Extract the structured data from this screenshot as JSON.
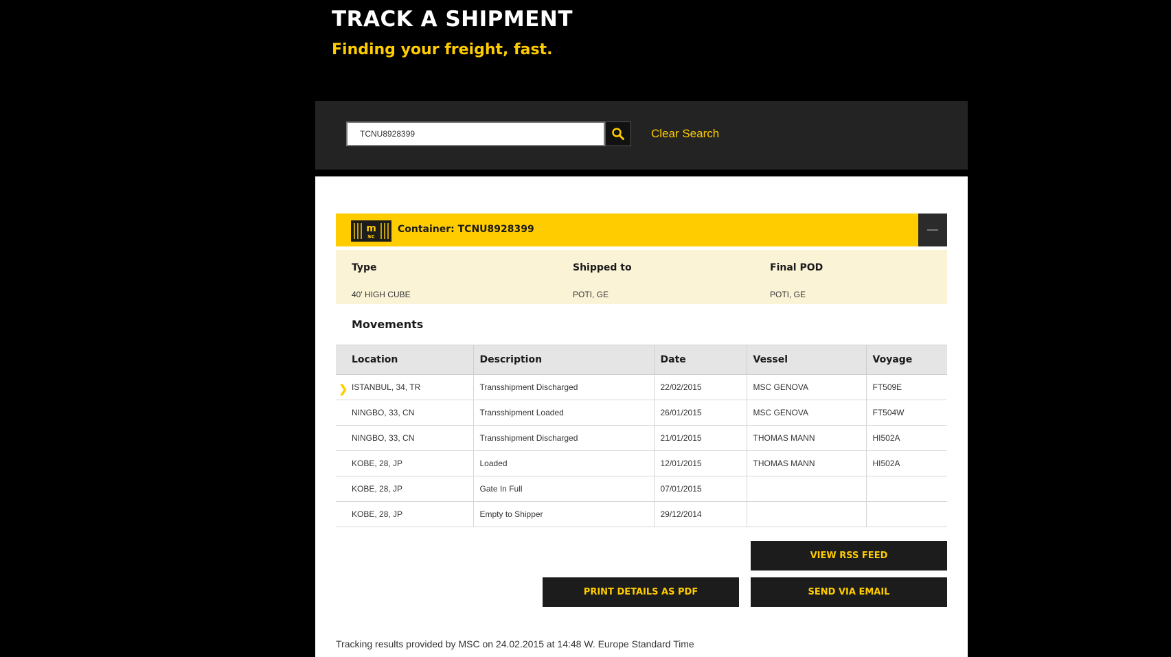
{
  "hero": {
    "title": "TRACK A SHIPMENT",
    "subtitle": "Finding your freight, fast."
  },
  "search": {
    "value": "TCNU8928399",
    "button_icon": "search-icon",
    "clear_label": "Clear Search"
  },
  "container": {
    "logo_text_top": "m",
    "logo_text_bottom": "sc",
    "title": "Container: TCNU8928399",
    "collapse_icon": "minus-icon",
    "info": {
      "type_label": "Type",
      "type_value": "40' HIGH CUBE",
      "shipped_to_label": "Shipped to",
      "shipped_to_value": "POTI, GE",
      "final_pod_label": "Final POD",
      "final_pod_value": "POTI, GE"
    }
  },
  "movements": {
    "title": "Movements",
    "columns": [
      "Location",
      "Description",
      "Date",
      "Vessel",
      "Voyage"
    ],
    "rows": [
      [
        "ISTANBUL, 34, TR",
        "Transshipment Discharged",
        "22/02/2015",
        "MSC GENOVA",
        "FT509E"
      ],
      [
        "NINGBO, 33, CN",
        "Transshipment Loaded",
        "26/01/2015",
        "MSC GENOVA",
        "FT504W"
      ],
      [
        "NINGBO, 33, CN",
        "Transshipment Discharged",
        "21/01/2015",
        "THOMAS MANN",
        "HI502A"
      ],
      [
        "KOBE, 28, JP",
        "Loaded",
        "12/01/2015",
        "THOMAS MANN",
        "HI502A"
      ],
      [
        "KOBE, 28, JP",
        "Gate In Full",
        "07/01/2015",
        "",
        ""
      ],
      [
        "KOBE, 28, JP",
        "Empty to Shipper",
        "29/12/2014",
        "",
        ""
      ]
    ]
  },
  "actions": {
    "rss_label": "VIEW RSS FEED",
    "pdf_label": "PRINT DETAILS AS PDF",
    "email_label": "SEND VIA EMAIL"
  },
  "footer": {
    "note": "Tracking results provided by MSC on 24.02.2015 at 14:48 W. Europe Standard Time"
  },
  "colors": {
    "accent": "#ffcc00",
    "background": "#000000",
    "dark_panel": "#232323"
  }
}
